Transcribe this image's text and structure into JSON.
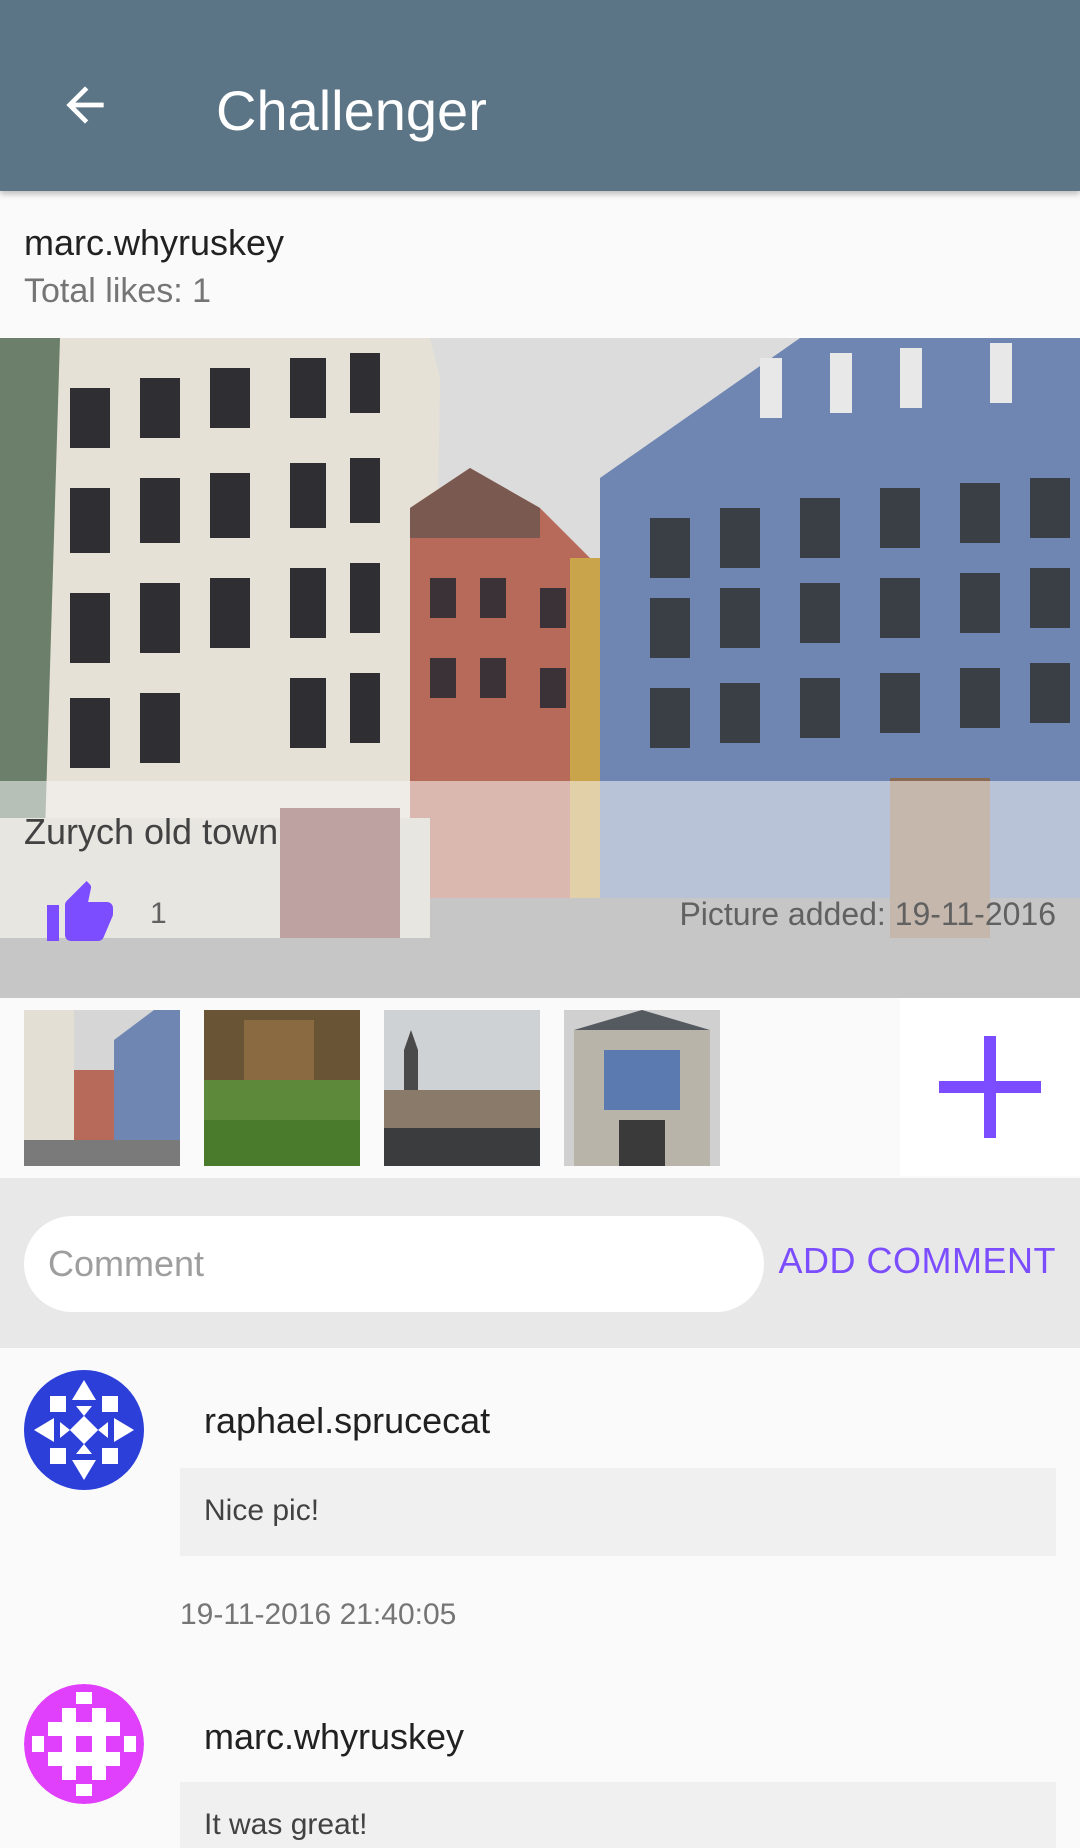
{
  "appbar": {
    "title": "Challenger",
    "back_icon": "arrow-left-icon"
  },
  "post": {
    "owner": "marc.whyruskey",
    "total_likes": "Total likes: 1",
    "caption": "Zurych old town",
    "like_count": "1",
    "picture_added": "Picture added: 19-11-2016",
    "like_icon": "thumbs-up-icon"
  },
  "thumbnails": [
    {
      "name": "thumbnail-1"
    },
    {
      "name": "thumbnail-2"
    },
    {
      "name": "thumbnail-3"
    },
    {
      "name": "thumbnail-4"
    }
  ],
  "add_photo_icon": "plus-icon",
  "comment_bar": {
    "placeholder": "Comment",
    "value": "",
    "button": "ADD COMMENT"
  },
  "comments": [
    {
      "user": "raphael.sprucecat",
      "text": "Nice pic!",
      "time": "19-11-2016 21:40:05"
    },
    {
      "user": "marc.whyruskey",
      "text": "It was great!",
      "time": ""
    }
  ],
  "colors": {
    "appbar": "#5b7586",
    "accent": "#7c4dff",
    "avatar_blue": "#2c3fd9",
    "avatar_magenta": "#e040fb"
  }
}
